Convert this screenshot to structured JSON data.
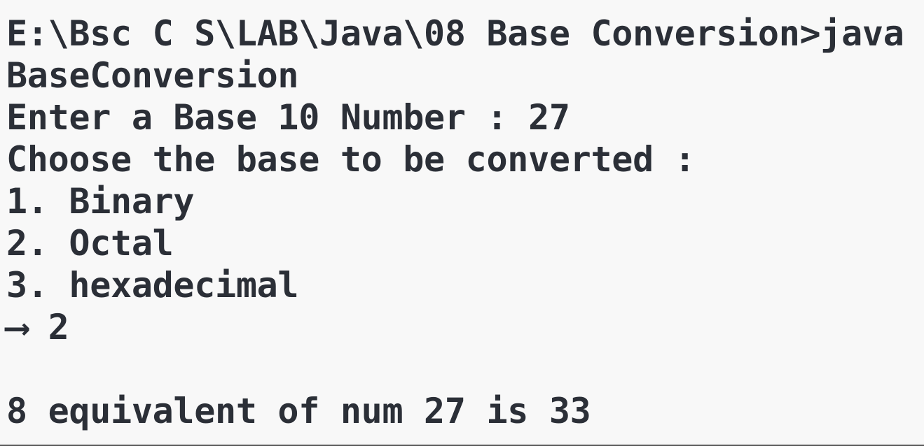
{
  "terminal": {
    "lines": [
      "E:\\Bsc C S\\LAB\\Java\\08 Base Conversion>java",
      "BaseConversion",
      "Enter a Base 10 Number : 27",
      "Choose the base to be converted :",
      "1. Binary",
      "2. Octal",
      "3. hexadecimal",
      "⟶ 2",
      "",
      "8 equivalent of num 27 is 33"
    ]
  }
}
